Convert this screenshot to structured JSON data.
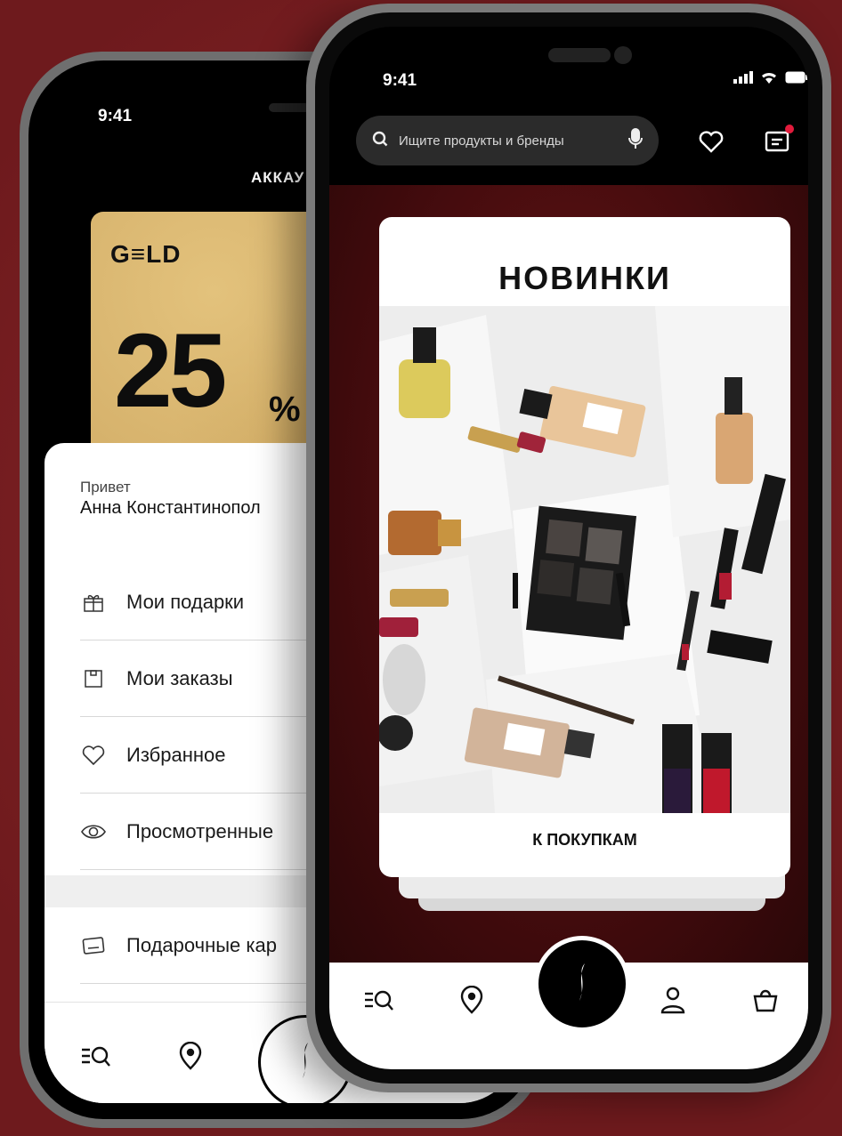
{
  "back_phone": {
    "status_time": "9:41",
    "screen_title": "АККАУ",
    "loyalty_card": {
      "tier_logo": "G≡LD",
      "discount_value": "25",
      "discount_unit": "%"
    },
    "greeting": {
      "label": "Привет",
      "name": "Анна Константинопол"
    },
    "menu": [
      {
        "label": "Мои подарки",
        "icon": "gift-icon"
      },
      {
        "label": "Мои заказы",
        "icon": "orders-box-icon"
      },
      {
        "label": "Избранное",
        "icon": "heart-icon"
      },
      {
        "label": "Просмотренные",
        "icon": "eye-icon"
      },
      {
        "label": "Подарочные кар",
        "icon": "gift-card-icon"
      }
    ],
    "tabbar": [
      "catalog-search-icon",
      "location-pin-icon",
      "home-logo-icon"
    ]
  },
  "front_phone": {
    "status_time": "9:41",
    "search": {
      "placeholder": "Ищите продукты и бренды"
    },
    "promo_card": {
      "title": "НОВИНКИ",
      "cta": "К ПОКУПКАМ"
    },
    "tabbar": [
      "catalog-search-icon",
      "location-pin-icon",
      "home-logo-icon",
      "profile-icon",
      "cart-bag-icon"
    ],
    "colors": {
      "notification_dot": "#e21b3c",
      "background": "#7a1f22"
    }
  }
}
